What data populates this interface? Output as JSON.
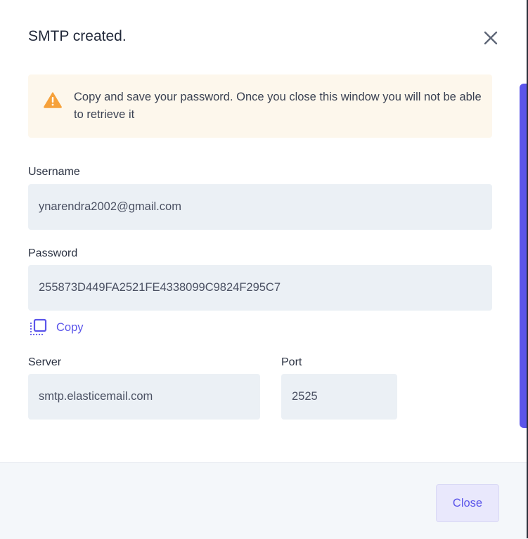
{
  "modal": {
    "title": "SMTP created.",
    "close_icon": "close-icon"
  },
  "alert": {
    "icon": "warning-icon",
    "text": "Copy and save your password. Once you close this window you will not be able to retrieve it",
    "color": "#f6a13a",
    "background": "#fdf7ec"
  },
  "fields": {
    "username": {
      "label": "Username",
      "value": "ynarendra2002@gmail.com"
    },
    "password": {
      "label": "Password",
      "value": "255873D449FA2521FE4338099C9824F295C7"
    },
    "server": {
      "label": "Server",
      "value": "smtp.elasticemail.com"
    },
    "port": {
      "label": "Port",
      "value": "2525"
    }
  },
  "copy": {
    "label": "Copy",
    "icon": "copy-icon"
  },
  "footer": {
    "close_label": "Close"
  },
  "colors": {
    "accent": "#5b55ea",
    "field_bg": "#ebf0f5"
  }
}
